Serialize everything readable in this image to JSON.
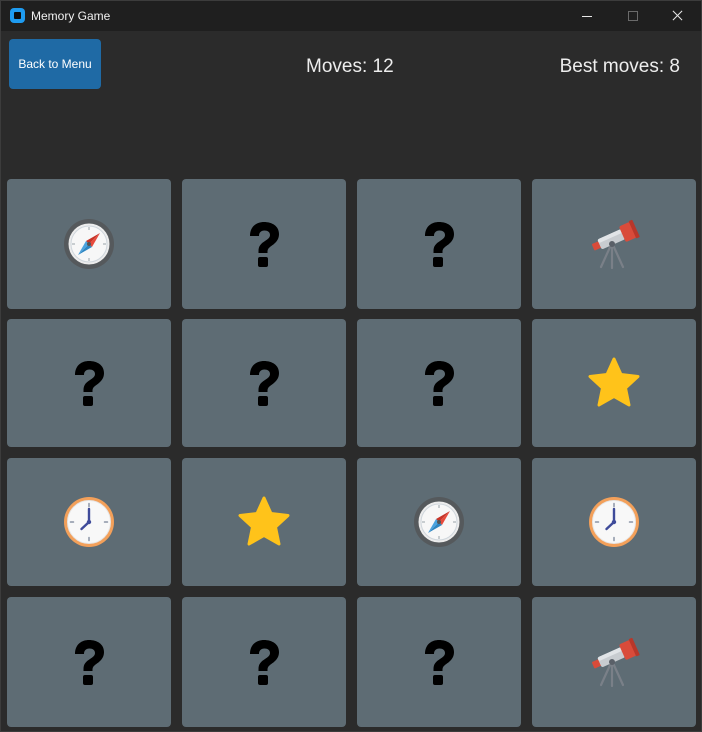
{
  "window": {
    "title": "Memory Game"
  },
  "header": {
    "back_label": "Back to Menu",
    "moves_label": "Moves: 12",
    "best_label": "Best moves: 8"
  },
  "colors": {
    "background": "#2b2b2b",
    "titlebar": "#1f1f1f",
    "card": "#5e6c74",
    "button": "#1f6aa5"
  },
  "board": {
    "rows": 4,
    "cols": 4,
    "cards": [
      {
        "face": "compass"
      },
      {
        "face": "hidden"
      },
      {
        "face": "hidden"
      },
      {
        "face": "telescope"
      },
      {
        "face": "hidden"
      },
      {
        "face": "hidden"
      },
      {
        "face": "hidden"
      },
      {
        "face": "star"
      },
      {
        "face": "clock"
      },
      {
        "face": "star"
      },
      {
        "face": "compass"
      },
      {
        "face": "clock"
      },
      {
        "face": "hidden"
      },
      {
        "face": "hidden"
      },
      {
        "face": "hidden"
      },
      {
        "face": "telescope"
      }
    ]
  }
}
